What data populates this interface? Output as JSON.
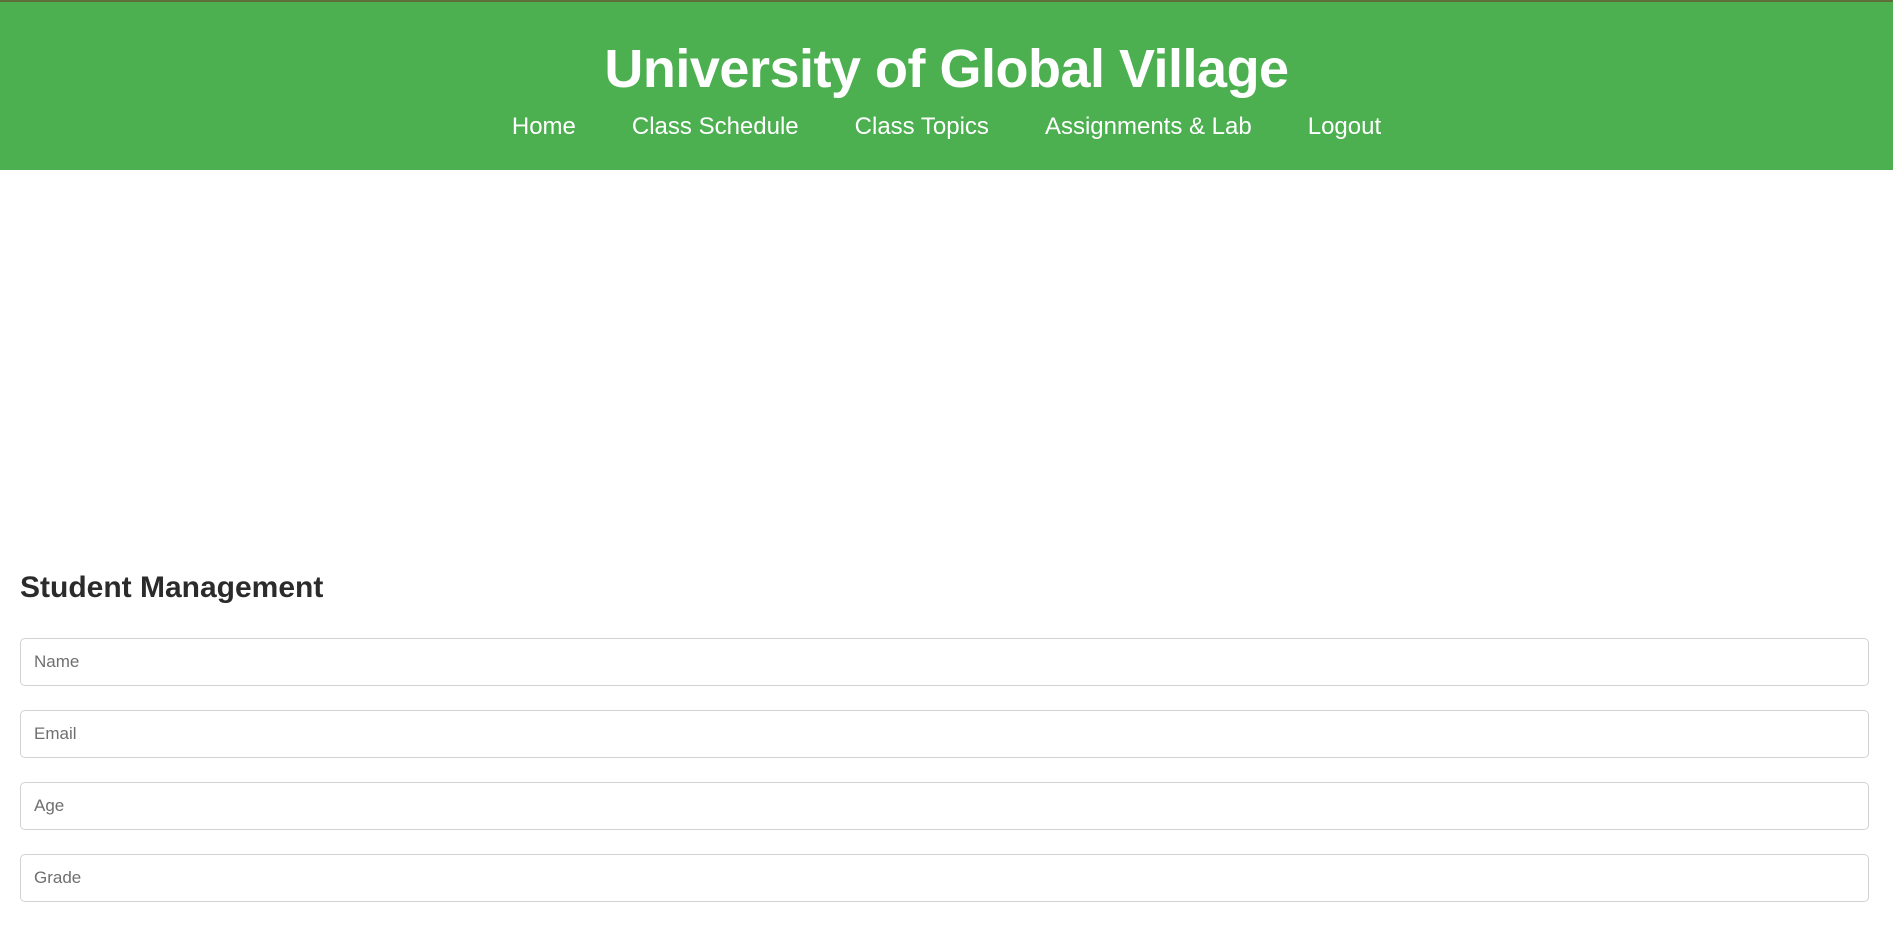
{
  "header": {
    "title": "University of Global Village",
    "bg_color": "#4caf50",
    "nav": [
      {
        "label": "Home"
      },
      {
        "label": "Class Schedule"
      },
      {
        "label": "Class Topics"
      },
      {
        "label": "Assignments & Lab"
      },
      {
        "label": "Logout"
      }
    ]
  },
  "student_management": {
    "title": "Student Management",
    "fields": {
      "name": {
        "placeholder": "Name",
        "value": ""
      },
      "email": {
        "placeholder": "Email",
        "value": ""
      },
      "age": {
        "placeholder": "Age",
        "value": ""
      },
      "grade": {
        "placeholder": "Grade",
        "value": ""
      }
    }
  }
}
